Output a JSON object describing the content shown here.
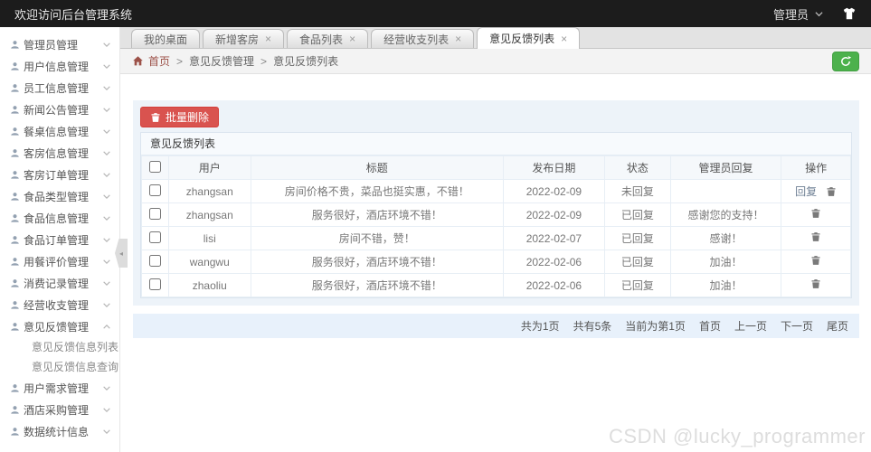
{
  "topbar": {
    "title": "欢迎访问后台管理系统",
    "user": "管理员"
  },
  "ui": {
    "close_glyph": "×",
    "crumb_sep": ">",
    "collapse_glyph": "◂"
  },
  "colors": {
    "topbar_bg": "#1c1c1c",
    "danger_red": "#d9534f",
    "success_green": "#4cb14c",
    "container_bg": "#edf3f9"
  },
  "tabs": {
    "items": [
      {
        "label": "我的桌面"
      },
      {
        "label": "新增客房"
      },
      {
        "label": "食品列表"
      },
      {
        "label": "经营收支列表"
      },
      {
        "label": "意见反馈列表"
      }
    ]
  },
  "breadcrumb": {
    "home": "首页",
    "section": "意见反馈管理",
    "page": "意见反馈列表"
  },
  "sidebar": {
    "items": [
      {
        "label": "管理员管理"
      },
      {
        "label": "用户信息管理"
      },
      {
        "label": "员工信息管理"
      },
      {
        "label": "新闻公告管理"
      },
      {
        "label": "餐桌信息管理"
      },
      {
        "label": "客房信息管理"
      },
      {
        "label": "客房订单管理"
      },
      {
        "label": "食品类型管理"
      },
      {
        "label": "食品信息管理"
      },
      {
        "label": "食品订单管理"
      },
      {
        "label": "用餐评价管理"
      },
      {
        "label": "消费记录管理"
      },
      {
        "label": "经营收支管理"
      },
      {
        "label": "意见反馈管理"
      },
      {
        "label": "用户需求管理"
      },
      {
        "label": "酒店采购管理"
      },
      {
        "label": "数据统计信息"
      }
    ],
    "subitems": [
      {
        "label": "意见反馈信息列表"
      },
      {
        "label": "意见反馈信息查询"
      }
    ]
  },
  "toolbar": {
    "batch_delete": "批量删除"
  },
  "panel": {
    "title": "意见反馈列表"
  },
  "table": {
    "headers": [
      "用户",
      "标题",
      "发布日期",
      "状态",
      "管理员回复",
      "操作"
    ],
    "reply_label": "回复",
    "rows": [
      {
        "user": "zhangsan",
        "title": "房间价格不贵，菜品也挺实惠，不错！",
        "date": "2022-02-09",
        "status": "未回复",
        "reply": ""
      },
      {
        "user": "zhangsan",
        "title": "服务很好，酒店环境不错！",
        "date": "2022-02-09",
        "status": "已回复",
        "reply": "感谢您的支持！"
      },
      {
        "user": "lisi",
        "title": "房间不错，赞！",
        "date": "2022-02-07",
        "status": "已回复",
        "reply": "感谢！"
      },
      {
        "user": "wangwu",
        "title": "服务很好，酒店环境不错！",
        "date": "2022-02-06",
        "status": "已回复",
        "reply": "加油！"
      },
      {
        "user": "zhaoliu",
        "title": "服务很好，酒店环境不错！",
        "date": "2022-02-06",
        "status": "已回复",
        "reply": "加油！"
      }
    ]
  },
  "pagination": {
    "total_pages": "共为1页",
    "total_items": "共有5条",
    "current": "当前为第1页",
    "first": "首页",
    "prev": "上一页",
    "next": "下一页",
    "last": "尾页"
  },
  "watermark": "CSDN @lucky_programmer"
}
